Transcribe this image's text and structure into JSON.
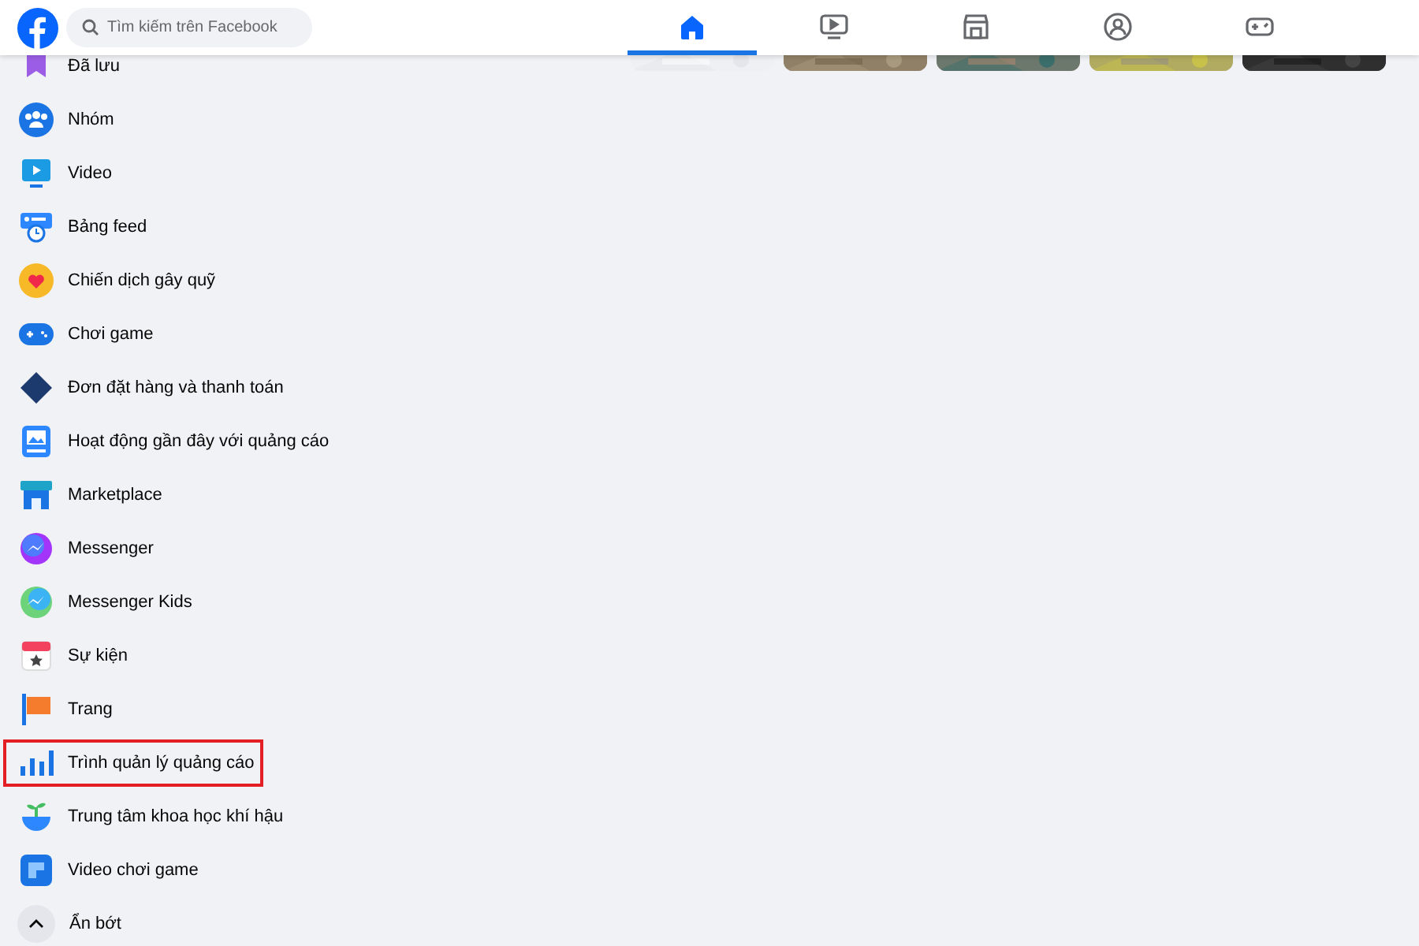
{
  "header": {
    "search": {
      "placeholder": "Tìm kiếm trên Facebook"
    },
    "tabs": [
      {
        "selected": true
      },
      {
        "selected": false
      },
      {
        "selected": false
      },
      {
        "selected": false
      },
      {
        "selected": false
      }
    ]
  },
  "sidebar": {
    "items": [
      {
        "label": "Đã lưu",
        "highlighted": false
      },
      {
        "label": "Nhóm",
        "highlighted": false
      },
      {
        "label": "Video",
        "highlighted": false
      },
      {
        "label": "Bảng feed",
        "highlighted": false
      },
      {
        "label": "Chiến dịch gây quỹ",
        "highlighted": false
      },
      {
        "label": "Chơi game",
        "highlighted": false
      },
      {
        "label": "Đơn đặt hàng và thanh toán",
        "highlighted": false
      },
      {
        "label": "Hoạt động gần đây với quảng cáo",
        "highlighted": false
      },
      {
        "label": "Marketplace",
        "highlighted": false
      },
      {
        "label": "Messenger",
        "highlighted": false
      },
      {
        "label": "Messenger Kids",
        "highlighted": false
      },
      {
        "label": "Sự kiện",
        "highlighted": false
      },
      {
        "label": "Trang",
        "highlighted": false
      },
      {
        "label": "Trình quản lý quảng cáo",
        "highlighted": true
      },
      {
        "label": "Trung tâm khoa học khí hậu",
        "highlighted": false
      },
      {
        "label": "Video chơi game",
        "highlighted": false
      }
    ],
    "collapse": {
      "label": "Ẩn bớt"
    }
  }
}
